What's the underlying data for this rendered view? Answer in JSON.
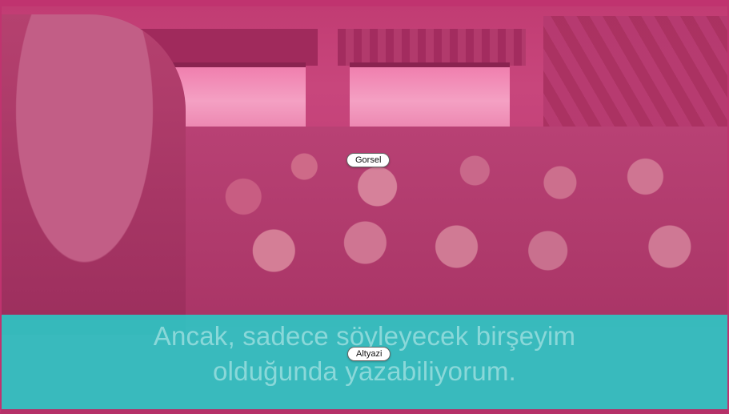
{
  "visual_region": {
    "label": "Gorsel"
  },
  "subtitle_region": {
    "label": "Altyazi",
    "lines": [
      "Ancak, sadece söyleyecek birşeyim",
      "olduğunda yazabiliyorum."
    ]
  },
  "colors": {
    "frame": "#c0336f",
    "overlay_tint": "#c13c73",
    "subtitle_band": "#28cdc8",
    "subtitle_text": "#cdf0f0"
  }
}
